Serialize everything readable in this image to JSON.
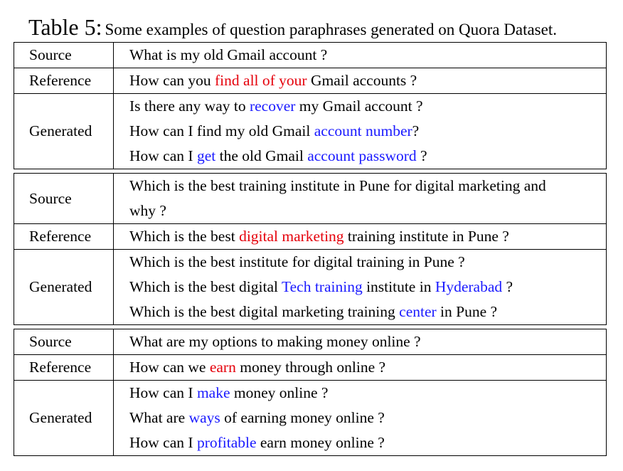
{
  "caption": {
    "label": "Table 5:",
    "text": "Some examples of question paraphrases generated on Quora Dataset."
  },
  "colors": {
    "red": "#e5000b",
    "blue": "#1a1aff"
  },
  "groups": [
    {
      "rows": [
        {
          "label": "Source",
          "lines": [
            [
              "What is my old Gmail account ?"
            ]
          ]
        },
        {
          "label": "Reference",
          "lines": [
            [
              "How can you ",
              {
                "t": "find all of your",
                "c": "red"
              },
              " Gmail accounts ?"
            ]
          ]
        },
        {
          "label": "Generated",
          "lines": [
            [
              "Is there any way to ",
              {
                "t": "recover",
                "c": "blue"
              },
              " my Gmail account ?"
            ],
            [
              "How can I find my old Gmail ",
              {
                "t": "account number",
                "c": "blue"
              },
              "?"
            ],
            [
              "How can I ",
              {
                "t": "get",
                "c": "blue"
              },
              " the old Gmail ",
              {
                "t": "account password",
                "c": "blue"
              },
              " ?"
            ]
          ]
        }
      ]
    },
    {
      "rows": [
        {
          "label": "Source",
          "lines": [
            [
              "Which is the best training institute in Pune for digital marketing and"
            ],
            [
              "why ?"
            ]
          ]
        },
        {
          "label": "Reference",
          "lines": [
            [
              "Which is the best ",
              {
                "t": "digital marketing",
                "c": "red"
              },
              " training institute in Pune ?"
            ]
          ]
        },
        {
          "label": "Generated",
          "lines": [
            [
              "Which is the best institute for digital training in Pune ?"
            ],
            [
              "Which is the best digital ",
              {
                "t": "Tech training",
                "c": "blue"
              },
              " institute in ",
              {
                "t": "Hyderabad",
                "c": "blue"
              },
              " ?"
            ],
            [
              "Which is the best digital marketing training ",
              {
                "t": "center",
                "c": "blue"
              },
              " in Pune ?"
            ]
          ]
        }
      ]
    },
    {
      "rows": [
        {
          "label": "Source",
          "lines": [
            [
              "What are my options to making money online ?"
            ]
          ]
        },
        {
          "label": "Reference",
          "lines": [
            [
              "How can we ",
              {
                "t": "earn",
                "c": "red"
              },
              " money through online ?"
            ]
          ]
        },
        {
          "label": "Generated",
          "lines": [
            [
              "How can I ",
              {
                "t": "make",
                "c": "blue"
              },
              " money online ?"
            ],
            [
              "What are ",
              {
                "t": "ways",
                "c": "blue"
              },
              " of earning money online ?"
            ],
            [
              "How can I ",
              {
                "t": "profitable",
                "c": "blue"
              },
              " earn money online ?"
            ]
          ]
        }
      ]
    }
  ]
}
